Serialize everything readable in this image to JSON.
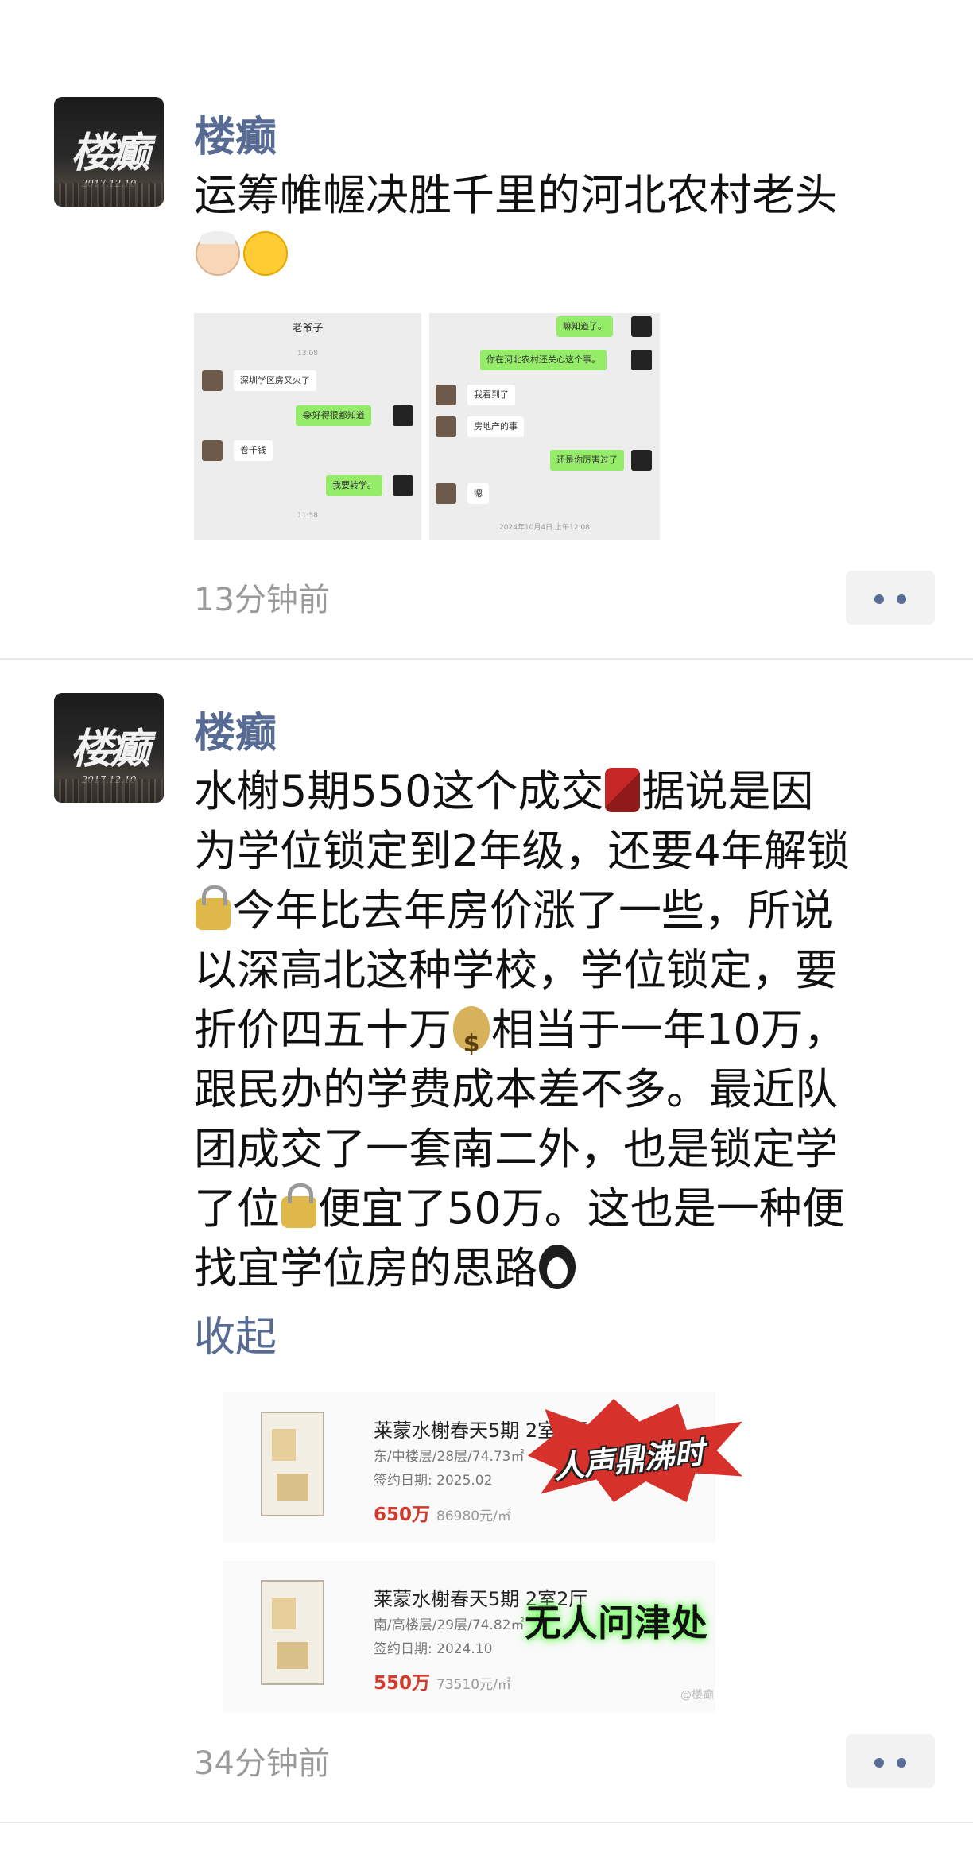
{
  "feed": {
    "posts": [
      {
        "username": "楼癫",
        "avatar_text": "楼癫",
        "avatar_date": "2017.12.10",
        "text": "运筹帷幄决胜千里的河北农村老头",
        "emojis": [
          "older-man-emoji",
          "thinking-face-emoji"
        ],
        "images": [
          {
            "header": "老爷子",
            "timestamp_top": "13:08",
            "timestamp_bottom": "11:58",
            "messages": [
              {
                "side": "left",
                "text": "深圳学区房又火了"
              },
              {
                "side": "right",
                "text": "😂好得很都知道"
              },
              {
                "side": "left",
                "text": "卷千钱"
              },
              {
                "side": "right",
                "text": "我要转学。"
              }
            ]
          },
          {
            "timestamp_bottom": "2024年10月4日 上午12:08",
            "messages": [
              {
                "side": "right",
                "text": "嘛知道了。"
              },
              {
                "side": "right",
                "text": "你在河北农村还关心这个事。"
              },
              {
                "side": "left",
                "text": "我看到了"
              },
              {
                "side": "left",
                "text": "房地产的事"
              },
              {
                "side": "right",
                "text": "还是你厉害过了"
              },
              {
                "side": "left",
                "text": "嗯"
              }
            ]
          }
        ],
        "time": "13分钟前"
      },
      {
        "username": "楼癫",
        "avatar_text": "楼癫",
        "avatar_date": "2017.12.10",
        "lines": [
          "水榭5期550这个成交",
          "据说是因",
          "为学位锁定到2年级，还要4年解锁",
          "今年比去年房价涨了一些，所说",
          "以深高北这种学校，学位锁定，要",
          "折价四五十万",
          "相当于一年10万，",
          "跟民办的学费成本差不多。最近队",
          "团成交了一套南二外，也是锁定学",
          "了位",
          "便宜了50万。这也是一种便",
          "找宜学位房的思路"
        ],
        "collapse_label": "收起",
        "listings": [
          {
            "title": "莱蒙水榭春天5期 2室2厅",
            "meta": "东/中楼层/28层/74.73㎡",
            "sign_date": "签约日期:  2025.02",
            "price": "650万",
            "unit_price": "86980元/㎡",
            "sticker": "人声鼎沸时"
          },
          {
            "title": "莱蒙水榭春天5期 2室2厅",
            "meta": "南/高楼层/29层/74.82㎡",
            "sign_date": "签约日期:  2024.10",
            "price": "550万",
            "unit_price": "73510元/㎡",
            "sticker": "无人问津处"
          }
        ],
        "watermark": "@楼癫",
        "time": "34分钟前"
      }
    ]
  },
  "colors": {
    "username": "#576b95",
    "time": "#9a9a9a",
    "price": "#d23a2c",
    "chat_bubble_right": "#95ec69"
  }
}
